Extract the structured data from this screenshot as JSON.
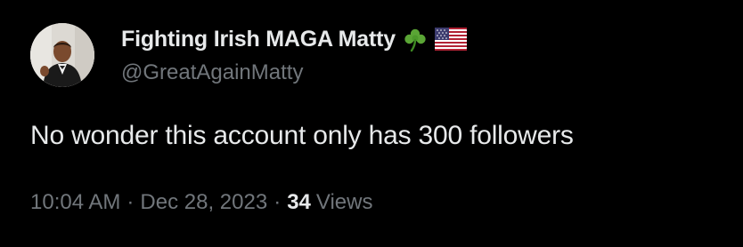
{
  "tweet": {
    "author": {
      "display_name": "Fighting Irish MAGA Matty",
      "handle": "@GreatAgainMatty",
      "avatar": "avatar-photo",
      "badges": [
        "shamrock-icon",
        "us-flag-icon"
      ]
    },
    "text": "No wonder this account only has 300 followers",
    "time": "10:04 AM",
    "separator": "·",
    "date": "Dec 28, 2023",
    "views_count": "34",
    "views_label": "Views"
  },
  "colors": {
    "background": "#000000",
    "primary_text": "#e7e9ea",
    "secondary_text": "#71767b",
    "shamrock": "#5aa535"
  }
}
